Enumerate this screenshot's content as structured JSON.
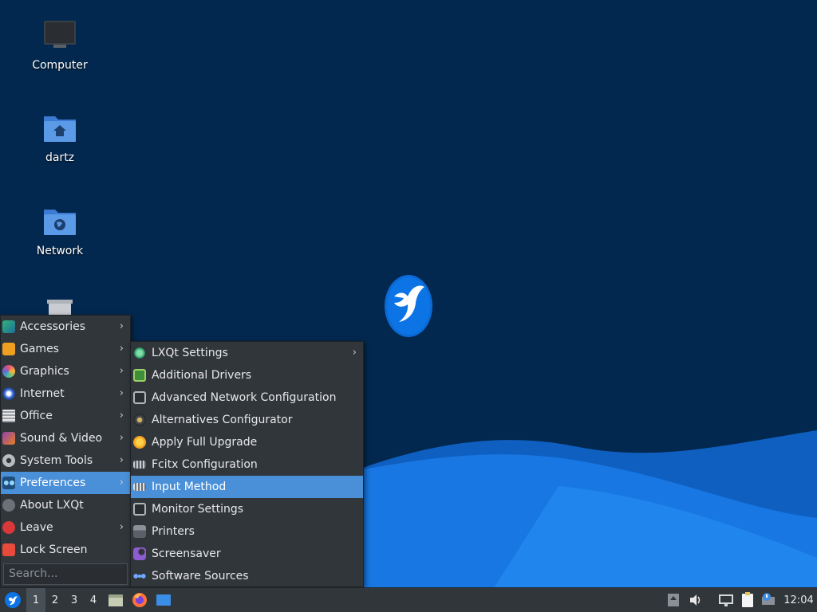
{
  "desktop": {
    "icons": [
      {
        "label": "Computer",
        "icon": "computer-icon"
      },
      {
        "label": "dartz",
        "icon": "home-folder-icon"
      },
      {
        "label": "Network",
        "icon": "network-folder-icon"
      },
      {
        "label": "",
        "icon": "trash-icon"
      }
    ]
  },
  "main_menu": {
    "items": [
      {
        "label": "Accessories",
        "icon": "accessories-icon",
        "submenu": true
      },
      {
        "label": "Games",
        "icon": "games-icon",
        "submenu": true
      },
      {
        "label": "Graphics",
        "icon": "graphics-icon",
        "submenu": true
      },
      {
        "label": "Internet",
        "icon": "internet-icon",
        "submenu": true
      },
      {
        "label": "Office",
        "icon": "office-icon",
        "submenu": true
      },
      {
        "label": "Sound & Video",
        "icon": "sound-video-icon",
        "submenu": true
      },
      {
        "label": "System Tools",
        "icon": "system-tools-icon",
        "submenu": true
      },
      {
        "label": "Preferences",
        "icon": "preferences-icon",
        "submenu": true,
        "highlighted": true
      },
      {
        "label": "About LXQt",
        "icon": "info-icon",
        "submenu": false
      },
      {
        "label": "Leave",
        "icon": "power-icon",
        "submenu": true
      },
      {
        "label": "Lock Screen",
        "icon": "lock-icon",
        "submenu": false
      }
    ],
    "search_placeholder": "Search..."
  },
  "sub_menu": {
    "items": [
      {
        "label": "LXQt Settings",
        "icon": "lxqt-settings-icon",
        "submenu": true
      },
      {
        "label": "Additional Drivers",
        "icon": "chip-icon",
        "submenu": false
      },
      {
        "label": "Advanced Network Configuration",
        "icon": "network-config-icon",
        "submenu": false
      },
      {
        "label": "Alternatives Configurator",
        "icon": "alternatives-icon",
        "submenu": false
      },
      {
        "label": "Apply Full Upgrade",
        "icon": "upgrade-icon",
        "submenu": false
      },
      {
        "label": "Fcitx Configuration",
        "icon": "keyboard-icon",
        "submenu": false
      },
      {
        "label": "Input Method",
        "icon": "keyboard-icon",
        "submenu": false,
        "highlighted": true
      },
      {
        "label": "Monitor Settings",
        "icon": "monitor-icon",
        "submenu": false
      },
      {
        "label": "Printers",
        "icon": "printer-icon",
        "submenu": false
      },
      {
        "label": "Screensaver",
        "icon": "screensaver-icon",
        "submenu": false
      },
      {
        "label": "Software Sources",
        "icon": "software-sources-icon",
        "submenu": false
      }
    ]
  },
  "taskbar": {
    "desktops": [
      "1",
      "2",
      "3",
      "4"
    ],
    "active_desktop": "1",
    "launchers": [
      "file-manager-icon",
      "firefox-icon",
      "show-desktop-icon"
    ],
    "tray": [
      "updates-icon",
      "volume-icon",
      "network-icon",
      "clipboard-icon",
      "notification-icon"
    ],
    "clock": "12:04"
  },
  "colors": {
    "wallpaper_dark": "#03284f",
    "wallpaper_wave": "#1a73d9",
    "menu_bg": "#31363b",
    "highlight": "#4a90d9"
  }
}
